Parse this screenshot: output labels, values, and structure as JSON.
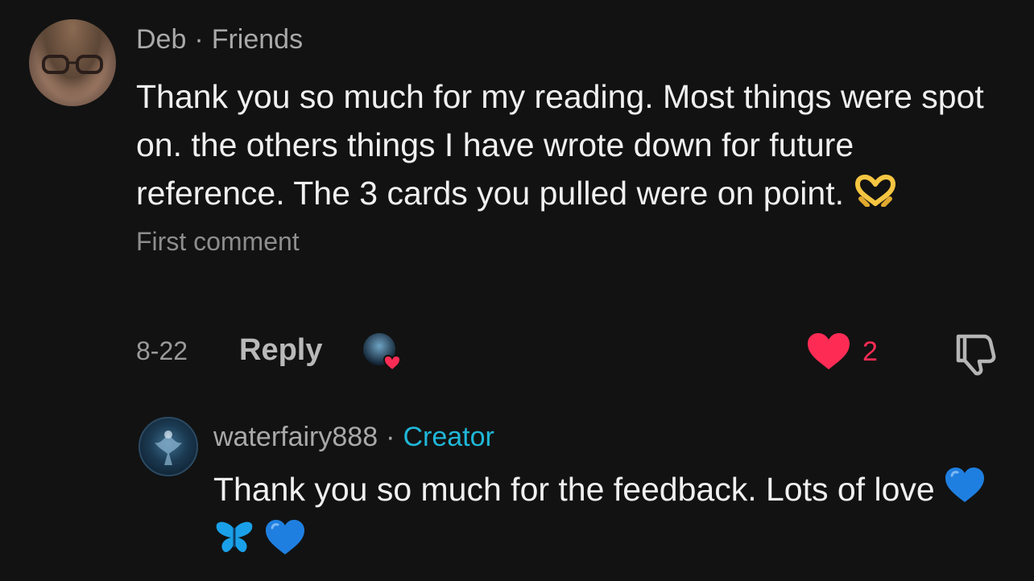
{
  "comment": {
    "author": "Deb",
    "separator": "·",
    "relation": "Friends",
    "text": "Thank you so much for my reading. Most things were spot on. the others things I have wrote down for future reference. The 3 cards you pulled were on point.",
    "emoji": "heart-hands",
    "subtext": "First comment",
    "date": "8-22",
    "reply_label": "Reply",
    "likes": "2"
  },
  "reply": {
    "author": "waterfairy888",
    "separator": "·",
    "badge": "Creator",
    "text": "Thank you so much for the feedback. Lots of love",
    "emojis": [
      "blue-heart",
      "butterfly",
      "blue-heart"
    ]
  },
  "colors": {
    "background": "#121212",
    "like_red": "#fe2c55",
    "creator_blue": "#20b7d8",
    "muted_text": "#a9a9a9"
  }
}
